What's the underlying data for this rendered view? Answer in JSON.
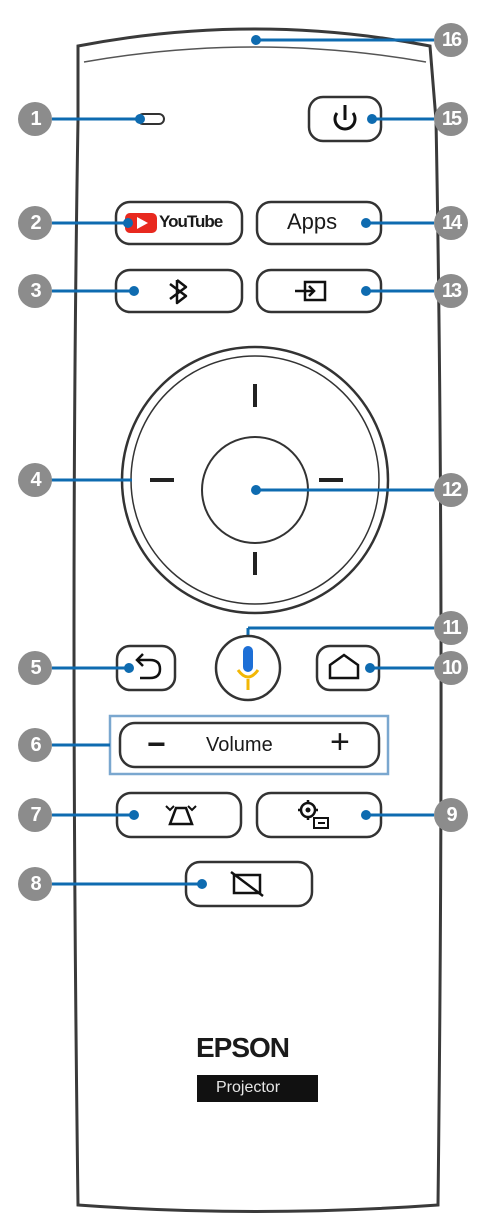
{
  "callouts": [
    "1",
    "2",
    "3",
    "4",
    "5",
    "6",
    "7",
    "8",
    "9",
    "10",
    "11",
    "12",
    "13",
    "14",
    "15",
    "16"
  ],
  "buttons": {
    "youtube": "YouTube",
    "apps": "Apps",
    "volume": "Volume",
    "volume_minus": "−",
    "volume_plus": "+"
  },
  "brand": {
    "name": "EPSON",
    "product": "Projector"
  },
  "icons": {
    "indicator": "indicator-light-icon",
    "youtube": "youtube-logo-icon",
    "bluetooth": "bluetooth-icon",
    "dpad": "directional-pad-icon",
    "back": "back-arrow-icon",
    "microphone": "microphone-icon",
    "home": "home-icon",
    "keystone": "keystone-icon",
    "settings": "settings-icon",
    "blank": "screen-off-icon",
    "input": "input-source-icon",
    "power": "power-icon",
    "sensor": "remote-sensor-icon"
  },
  "colors": {
    "leader": "#0e6bb0",
    "callout": "#8c8c8c",
    "youtube_red": "#e8291f",
    "mic_blue": "#1d6fd6",
    "mic_yellow": "#f2b705"
  }
}
